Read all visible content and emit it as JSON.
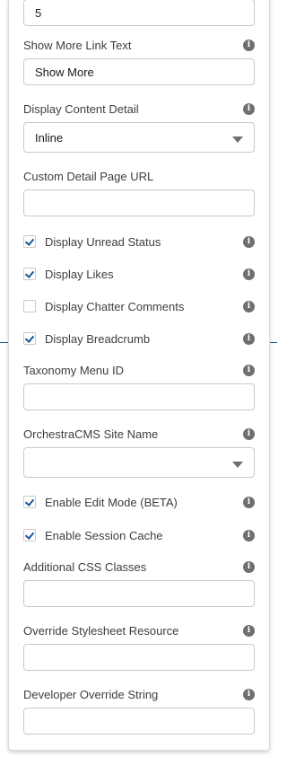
{
  "top_field": {
    "value": "5"
  },
  "show_more_link_text": {
    "label": "Show More Link Text",
    "value": "Show More"
  },
  "display_content_detail": {
    "label": "Display Content Detail",
    "selected": "Inline"
  },
  "custom_detail_page_url": {
    "label": "Custom Detail Page URL",
    "value": ""
  },
  "checkboxes_group1": [
    {
      "label": "Display Unread Status",
      "checked": true
    },
    {
      "label": "Display Likes",
      "checked": true
    },
    {
      "label": "Display Chatter Comments",
      "checked": false
    },
    {
      "label": "Display Breadcrumb",
      "checked": true
    }
  ],
  "taxonomy_menu_id": {
    "label": "Taxonomy Menu ID",
    "value": ""
  },
  "orchestracms_site_name": {
    "label": "OrchestraCMS Site Name",
    "selected": ""
  },
  "checkboxes_group2": [
    {
      "label": "Enable Edit Mode (BETA)",
      "checked": true
    },
    {
      "label": "Enable Session Cache",
      "checked": true
    }
  ],
  "additional_css_classes": {
    "label": "Additional CSS Classes",
    "value": ""
  },
  "override_stylesheet_resource": {
    "label": "Override Stylesheet Resource",
    "value": ""
  },
  "developer_override_string": {
    "label": "Developer Override String",
    "value": ""
  },
  "icons": {
    "info": "info-icon",
    "chevron": "chevron-down-icon",
    "check": "checkmark-icon"
  },
  "colors": {
    "accent": "#1b5297",
    "border": "#c9c9c9",
    "label": "#3e3e3c"
  }
}
